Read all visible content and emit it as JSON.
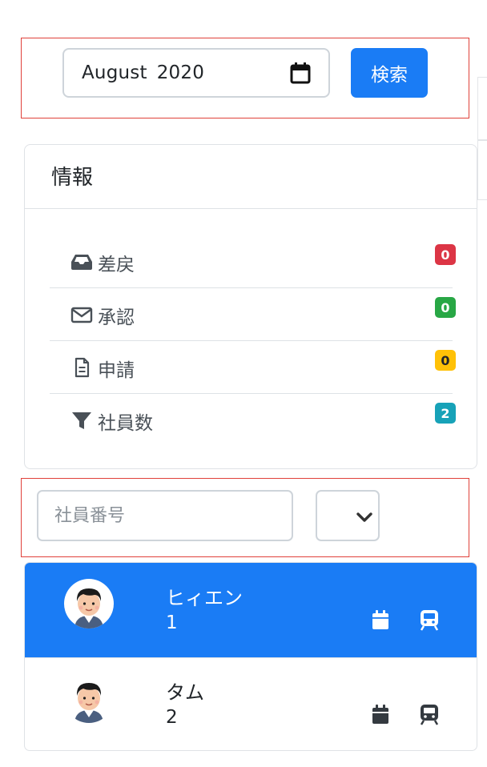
{
  "search": {
    "month_value": [
      "August",
      "2020"
    ],
    "button_label": "検索"
  },
  "info_card": {
    "title": "情報",
    "items": [
      {
        "label": "差戻",
        "count": "0",
        "badge_color": "#dc3545",
        "icon": "inbox-icon"
      },
      {
        "label": "承認",
        "count": "0",
        "badge_color": "#28a745",
        "icon": "envelope-icon"
      },
      {
        "label": "申請",
        "count": "0",
        "badge_color": "#ffc107",
        "icon": "file-icon"
      },
      {
        "label": "社員数",
        "count": "2",
        "badge_color": "#17a2b8",
        "icon": "filter-icon"
      }
    ]
  },
  "filter": {
    "employee_number_placeholder": "社員番号",
    "select_value": ""
  },
  "employees": [
    {
      "name": "ヒィエン",
      "number": "1",
      "active": true,
      "icons": [
        "calendar-icon",
        "train-icon"
      ]
    },
    {
      "name": "タム",
      "number": "2",
      "active": false,
      "icons": [
        "calendar-icon",
        "train-icon"
      ]
    }
  ],
  "colors": {
    "primary": "#1a7cf5",
    "highlight_border": "#e0413a",
    "danger": "#dc3545",
    "success": "#28a745",
    "warning": "#ffc107",
    "info": "#17a2b8"
  }
}
